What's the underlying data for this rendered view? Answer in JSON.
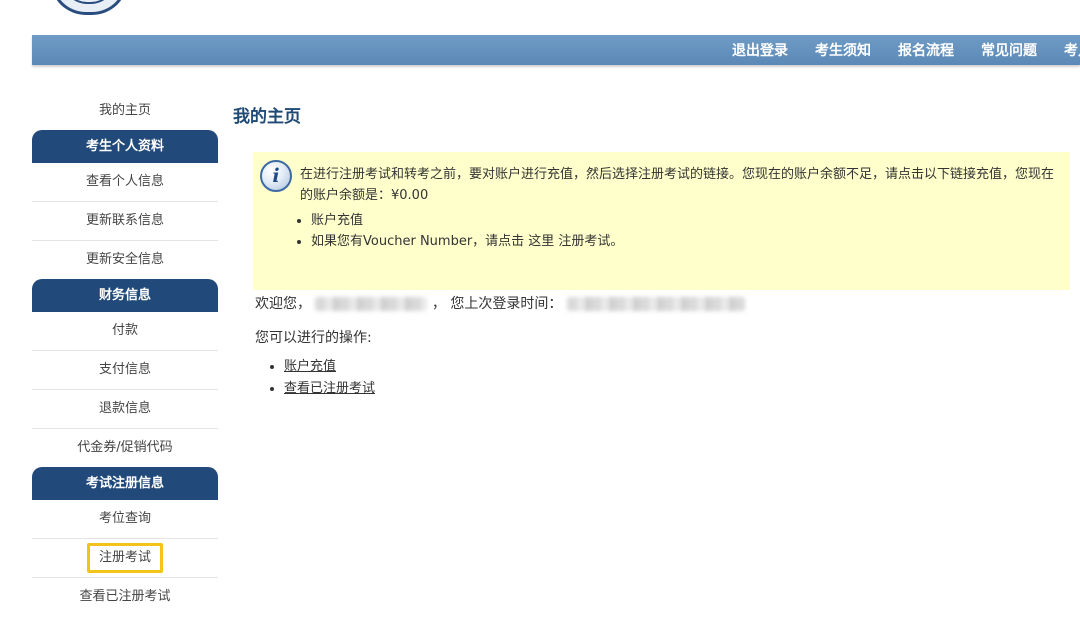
{
  "topnav": {
    "items": [
      "退出登录",
      "考生须知",
      "报名流程",
      "常见问题",
      "考点"
    ]
  },
  "sidebar": {
    "home": "我的主页",
    "section_profile": "考生个人资料",
    "view_profile": "查看个人信息",
    "update_contact": "更新联系信息",
    "update_security": "更新安全信息",
    "section_finance": "财务信息",
    "payment": "付款",
    "payment_info": "支付信息",
    "refund_info": "退款信息",
    "voucher": "代金券/促销代码",
    "section_exam": "考试注册信息",
    "seat_query": "考位查询",
    "register_exam": "注册考试",
    "view_registered": "查看已注册考试"
  },
  "main": {
    "title": "我的主页",
    "notice": {
      "text": "在进行注册考试和转考之前，要对账户进行充值，然后选择注册考试的链接。您现在的账户余额不足，请点击以下链接充值，您现在的账户余额是：¥0.00",
      "bullet_1": "账户充值",
      "bullet_2": "如果您有Voucher Number，请点击 这里 注册考试。"
    },
    "welcome_prefix": "欢迎您，",
    "last_login_label": "， 您上次登录时间：",
    "ops_label": "您可以进行的操作:",
    "ops": {
      "recharge": "账户充值",
      "view_registered": "查看已注册考试"
    }
  },
  "colors": {
    "topbar": "#6393c0",
    "section_header": "#214a7a",
    "notice_bg": "#ffffcc",
    "highlight": "#f2c318",
    "title": "#1f4a75"
  }
}
